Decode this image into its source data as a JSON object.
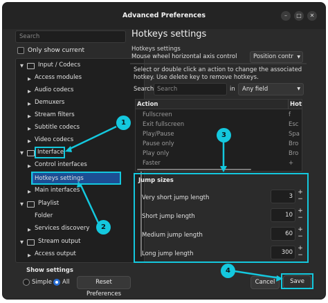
{
  "window": {
    "title": "Advanced Preferences",
    "minimize_glyph": "–",
    "maximize_glyph": "□",
    "close_glyph": "✕"
  },
  "sidebar": {
    "search_placeholder": "Search",
    "only_show_current": "Only show current",
    "tree": [
      {
        "label": "Input / Codecs",
        "level": 0,
        "expanded": true,
        "icon": "input-codecs-icon"
      },
      {
        "label": "Access modules",
        "level": 1
      },
      {
        "label": "Audio codecs",
        "level": 1
      },
      {
        "label": "Demuxers",
        "level": 1
      },
      {
        "label": "Stream filters",
        "level": 1
      },
      {
        "label": "Subtitle codecs",
        "level": 1
      },
      {
        "label": "Video codecs",
        "level": 1
      },
      {
        "label": "Interface",
        "level": 0,
        "expanded": true,
        "icon": "interface-icon"
      },
      {
        "label": "Control interfaces",
        "level": 1
      },
      {
        "label": "Hotkeys settings",
        "level": 1,
        "selected": true
      },
      {
        "label": "Main interfaces",
        "level": 1
      },
      {
        "label": "Playlist",
        "level": 0,
        "expanded": true,
        "icon": "playlist-icon"
      },
      {
        "label": "Folder",
        "level": 1
      },
      {
        "label": "Services discovery",
        "level": 1
      },
      {
        "label": "Stream output",
        "level": 0,
        "expanded": true,
        "icon": "stream-output-icon"
      },
      {
        "label": "Access output",
        "level": 1
      }
    ]
  },
  "main": {
    "section_title": "Hotkeys settings",
    "subsection": "Hotkeys settings",
    "clipped_label": "Mouse wheel horizontal axis control",
    "clipped_select": "Position contr",
    "description": "Select or double click an action to change the associated hotkey. Use delete key to remove hotkeys.",
    "search_label": "Search",
    "search_placeholder": "Search",
    "in_label": "in",
    "field_select": "Any field",
    "table": {
      "col_action": "Action",
      "col_hotkey": "Hot",
      "rows": [
        {
          "action": "Fullscreen",
          "hotkey": "f"
        },
        {
          "action": "Exit fullscreen",
          "hotkey": "Esc"
        },
        {
          "action": "Play/Pause",
          "hotkey": "Spa"
        },
        {
          "action": "Pause only",
          "hotkey": "Bro"
        },
        {
          "action": "Play only",
          "hotkey": "Bro"
        },
        {
          "action": "Faster",
          "hotkey": "+"
        }
      ]
    },
    "jump_sizes": {
      "title": "Jump sizes",
      "items": [
        {
          "label": "Very short jump length",
          "value": "3"
        },
        {
          "label": "Short jump length",
          "value": "10"
        },
        {
          "label": "Medium jump length",
          "value": "60"
        },
        {
          "label": "Long jump length",
          "value": "300"
        }
      ]
    }
  },
  "footer": {
    "show_settings": "Show settings",
    "simple": "Simple",
    "all": "All",
    "reset": "Reset Preferences",
    "cancel": "Cancel",
    "save": "Save",
    "selected_mode": "All"
  },
  "annotations": {
    "markers": [
      "1",
      "2",
      "3",
      "4"
    ],
    "accent_color": "#14c8de"
  }
}
